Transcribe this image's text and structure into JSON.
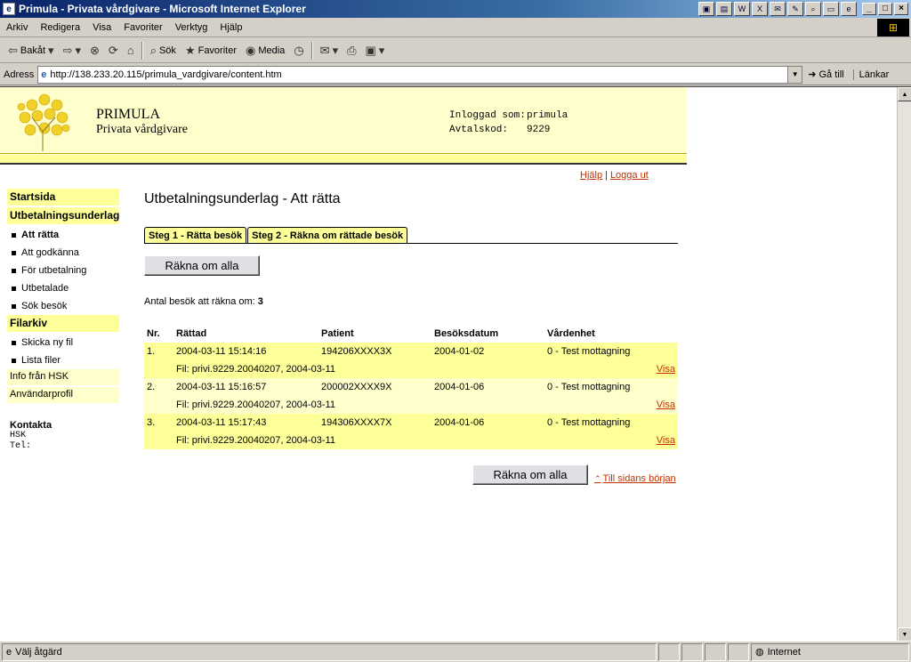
{
  "window": {
    "title": "Primula - Privata vårdgivare - Microsoft Internet Explorer",
    "minimize": "_",
    "maximize": "□",
    "close": "×"
  },
  "menu": [
    "Arkiv",
    "Redigera",
    "Visa",
    "Favoriter",
    "Verktyg",
    "Hjälp"
  ],
  "toolbar": {
    "back": "Bakåt",
    "search": "Sök",
    "favorites": "Favoriter",
    "media": "Media"
  },
  "address": {
    "label": "Adress",
    "url": "http://138.233.20.115/primula_vardgivare/content.htm",
    "go": "Gå till",
    "links": "Länkar"
  },
  "header": {
    "brand_title": "PRIMULA",
    "brand_subtitle": "Privata vårdgivare",
    "login_label": "Inloggad som:",
    "login_value": "primula",
    "code_label": "Avtalskod:",
    "code_value": "9229"
  },
  "top_links": {
    "help": "Hjälp",
    "logout": "Logga ut"
  },
  "sidebar": {
    "start": "Startsida",
    "section1": "Utbetalningsunderlag",
    "section1_items": [
      "Att rätta",
      "Att godkänna",
      "För utbetalning",
      "Utbetalade",
      "Sök besök"
    ],
    "section2": "Filarkiv",
    "section2_items": [
      "Skicka ny fil",
      "Lista filer"
    ],
    "info": "Info från HSK",
    "profile": "Användarprofil",
    "contact_title": "Kontakta",
    "contact_org": "HSK",
    "contact_tel": "Tel:"
  },
  "main": {
    "title": "Utbetalningsunderlag - Att rätta",
    "tabs": [
      "Steg 1 - Rätta besök",
      "Steg 2 - Räkna om rättade besök"
    ],
    "recalc_button": "Räkna om alla",
    "count_label": "Antal besök att räkna om:",
    "count_value": "3",
    "columns": [
      "Nr.",
      "Rättad",
      "Patient",
      "Besöksdatum",
      "Vårdenhet"
    ],
    "rows": [
      {
        "nr": "1.",
        "rattad": "2004-03-11 15:14:16",
        "patient": "194206XXXX3X",
        "datum": "2004-01-02",
        "enhet": "0 - Test mottagning",
        "fil": "Fil: privi.9229.20040207, 2004-03-11",
        "visa": "Visa"
      },
      {
        "nr": "2.",
        "rattad": "2004-03-11 15:16:57",
        "patient": "200002XXXX9X",
        "datum": "2004-01-06",
        "enhet": "0 - Test mottagning",
        "fil": "Fil: privi.9229.20040207, 2004-03-11",
        "visa": "Visa"
      },
      {
        "nr": "3.",
        "rattad": "2004-03-11 15:17:43",
        "patient": "194306XXXX7X",
        "datum": "2004-01-06",
        "enhet": "0 - Test mottagning",
        "fil": "Fil: privi.9229.20040207, 2004-03-11",
        "visa": "Visa"
      }
    ],
    "top_of_page": "Till sidans början"
  },
  "status": {
    "text": "Välj åtgärd",
    "zone": "Internet"
  },
  "colors": {
    "header_bg": "#ffffcc",
    "accent_yellow": "#ffff99",
    "link": "#c03000",
    "titlebar": "#0a246a"
  }
}
